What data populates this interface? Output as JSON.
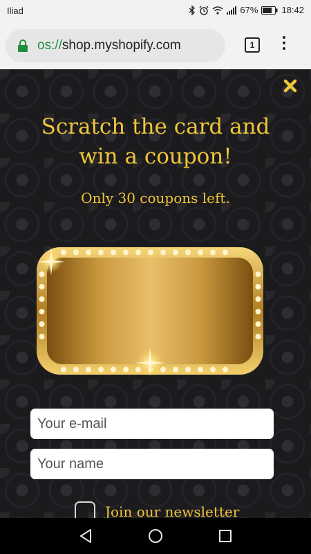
{
  "status_bar": {
    "carrier": "Iliad",
    "battery": "67%",
    "time": "18:42",
    "icons": [
      "bluetooth-icon",
      "alarm-icon",
      "wifi-icon",
      "signal-icon",
      "battery-icon"
    ]
  },
  "browser": {
    "url_scheme": "os://",
    "url_host": "shop.myshopify.com",
    "tab_count": "1",
    "icons": [
      "lock-icon",
      "menu-dots-icon"
    ]
  },
  "popup": {
    "title_line1": "Scratch the card and",
    "title_line2": "win a coupon!",
    "subtitle": "Only 30 coupons left.",
    "email_placeholder": "Your e-mail",
    "name_placeholder": "Your name",
    "newsletter_label": "Join our newsletter",
    "accent_color": "#f0c53a",
    "icons": [
      "close-icon"
    ]
  },
  "nav_bar": {
    "icons": [
      "back-icon",
      "home-icon",
      "recents-icon"
    ]
  }
}
